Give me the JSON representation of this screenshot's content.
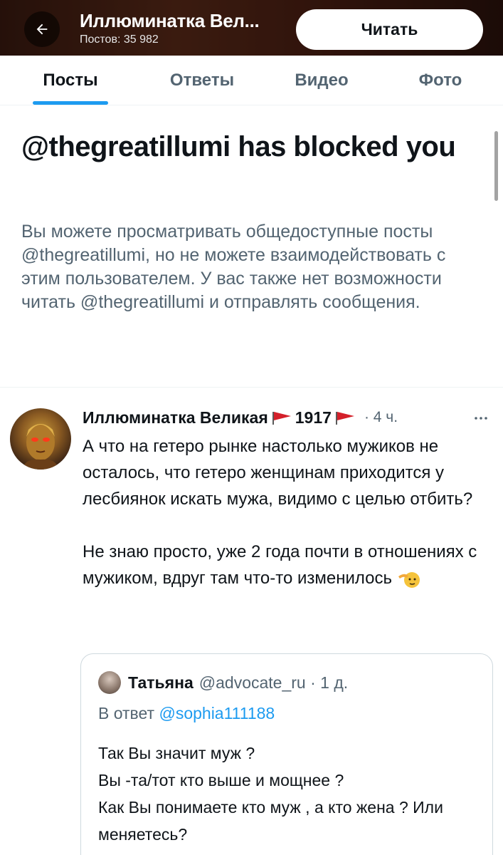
{
  "header": {
    "title": "Иллюминатка Вел...",
    "posts_count": "Постов: 35 982",
    "follow_label": "Читать",
    "back_icon": "arrow-left-icon"
  },
  "tabs": [
    {
      "label": "Посты",
      "active": true
    },
    {
      "label": "Ответы",
      "active": false
    },
    {
      "label": "Видео",
      "active": false
    },
    {
      "label": "Фото",
      "active": false
    }
  ],
  "blocked": {
    "title": "@thegreatillumi has blocked you",
    "body": "Вы можете просматривать общедоступные посты @thegreatillumi, но не можете взаимодействовать с этим пользователем. У вас также нет возможности читать @thegreatillumi и отправлять сообщения."
  },
  "post": {
    "author": "Иллюминатка Великая",
    "year": "1917",
    "time": "· 4 ч.",
    "text": "А что на гетеро рынке настолько мужиков не осталось, что гетеро женщинам приходится у лесбиянок искать мужа, видимо с целью отбить?\n\nНе знаю просто, уже 2 года почти в отношениях с мужиком, вдруг там что-то изменилось",
    "emoji": "saluting-face-icon",
    "flag_color": "#d4202a"
  },
  "quote": {
    "name": "Татьяна",
    "handle": "@advocate_ru · 1 д.",
    "reply_prefix": "В ответ",
    "reply_to": "@sophia111188",
    "text": "Так Вы значит муж ?\nВы -та/тот кто выше  и мощнее ?\nКак Вы понимаете  кто муж , а кто жена ? Или меняетесь?"
  },
  "colors": {
    "accent": "#1d9bf0",
    "secondary_text": "#536471",
    "primary_text": "#0f1419"
  }
}
